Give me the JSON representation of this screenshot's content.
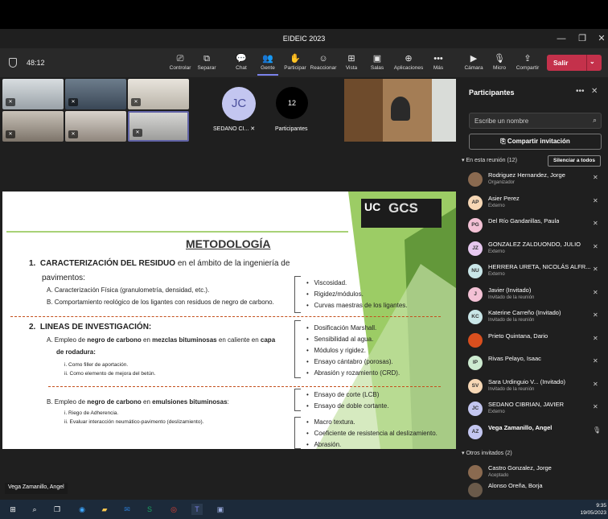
{
  "window": {
    "title": "EIDEIC 2023"
  },
  "toolbar": {
    "timer": "48:12",
    "buttons": [
      {
        "label": "Controlar",
        "icon": "screen-control-icon"
      },
      {
        "label": "Separar",
        "icon": "popout-icon"
      },
      {
        "label": "Chat",
        "icon": "chat-icon"
      },
      {
        "label": "Gente",
        "icon": "people-icon"
      },
      {
        "label": "Participar",
        "icon": "raise-hand-icon"
      },
      {
        "label": "Reaccionar",
        "icon": "smiley-icon"
      },
      {
        "label": "Vista",
        "icon": "grid-icon"
      },
      {
        "label": "Salas",
        "icon": "rooms-icon"
      },
      {
        "label": "Aplicaciones",
        "icon": "add-app-icon"
      },
      {
        "label": "Más",
        "icon": "more-icon"
      },
      {
        "label": "Cámara",
        "icon": "camera-icon"
      },
      {
        "label": "Micro",
        "icon": "mic-off-icon"
      },
      {
        "label": "Compartir",
        "icon": "share-icon"
      }
    ],
    "leave_label": "Salir"
  },
  "stage": {
    "avatar_initials": "JC",
    "avatar_name": "SEDANO CI...",
    "participant_count": "12",
    "participant_count_label": "Participantes",
    "speaker_name": "Vega Zamanillo, Angel"
  },
  "slide": {
    "logo_uc": "UC",
    "logo_gcs": "GCS",
    "title": "METODOLOGÍA",
    "s1_num": "1.",
    "s1_bold": "CARACTERIZACIÓN DEL RESIDUO",
    "s1_rest": " en el ámbito de la ingeniería de",
    "s1_cont": "pavimentos:",
    "s1_a": "A.  Caracterización Física (granulometría, densidad, etc.).",
    "s1_b": "B.  Comportamiento reológico de los ligantes con residuos de negro de carbono.",
    "s1_list": [
      "Viscosidad.",
      "Rigidez/módulos.",
      "Curvas maestras de los ligantes."
    ],
    "s2_num": "2.",
    "s2_bold": "LINEAS DE INVESTIGACIÓN:",
    "s2_a_pre": "A.  Empleo de ",
    "s2_a_b1": "negro de carbono",
    "s2_a_mid": " en ",
    "s2_a_b2": "mezclas bituminosas",
    "s2_a_post": " en caliente en ",
    "s2_a_b3": "capa",
    "s2_a_cont": "de rodadura:",
    "s2_a_i": "i.   Como filler de aportación.",
    "s2_a_ii": "ii.  Como elemento de mejora del betún.",
    "s2_a_list": [
      "Dosificación Marshall.",
      "Sensibilidad al agua.",
      "Módulos y rigidez.",
      "Ensayo cántabro (porosas).",
      "Abrasión y rozamiento (CRD)."
    ],
    "s2_b_pre": "B.   Empleo de ",
    "s2_b_b1": "negro de carbono",
    "s2_b_mid": " en ",
    "s2_b_b2": "emulsiones bituminosas",
    "s2_b_post": ":",
    "s2_b_i": "i.    Riego de Adherencia.",
    "s2_b_ii": "ii.   Evaluar interacción neumático-pavimento (deslizamiento).",
    "s2_b_list1": [
      "Ensayo de corte (LCB)",
      "Ensayo de doble cortante."
    ],
    "s2_b_list2": [
      "Macro textura.",
      "Coeficiente de resistencia al deslizamiento.",
      "Abrasión."
    ]
  },
  "panel": {
    "title": "Participantes",
    "search_placeholder": "Escribe un nombre",
    "invite_label": "Compartir invitación",
    "in_meeting": "En esta reunión (12)",
    "mute_all": "Silenciar a todos",
    "participants": [
      {
        "initials": "",
        "name": "Rodriguez Hernandez, Jorge",
        "sub": "Organizador",
        "color": "#8a6a50"
      },
      {
        "initials": "AP",
        "name": "Asier Perez",
        "sub": "Externo",
        "color": "#f6d7b5"
      },
      {
        "initials": "PG",
        "name": "Del Río Gandarillas, Paula",
        "sub": "",
        "color": "#f3c1d5"
      },
      {
        "initials": "JZ",
        "name": "GONZALEZ ZALDUONDO, JULIO",
        "sub": "Externo",
        "color": "#e7c8f0"
      },
      {
        "initials": "NU",
        "name": "HERRERA URETA, NICOLÁS ALFR...",
        "sub": "Externo",
        "color": "#c9e6e8"
      },
      {
        "initials": "J",
        "name": "Javier (Invitado)",
        "sub": "Invitado de la reunión",
        "color": "#f3c1d5"
      },
      {
        "initials": "KC",
        "name": "Katerine Carreño (Invitado)",
        "sub": "Invitado de la reunión",
        "color": "#c9e6e8"
      },
      {
        "initials": "",
        "name": "Prieto Quintana, Dario",
        "sub": "",
        "color": "#d94f1e"
      },
      {
        "initials": "IP",
        "name": "Rivas Pelayo, Isaac",
        "sub": "",
        "color": "#cdebd0"
      },
      {
        "initials": "SV",
        "name": "Sara Urdinguio V... (Invitado)",
        "sub": "Invitado de la reunión",
        "color": "#f6d7b5"
      },
      {
        "initials": "JC",
        "name": "SEDANO CIBRIAN, JAVIER",
        "sub": "Externo",
        "color": "#c3c6f0"
      },
      {
        "initials": "AZ",
        "name": "Vega Zamanillo, Angel",
        "sub": "",
        "color": "#c3c6f0"
      }
    ],
    "others": "Otros invitados (2)",
    "others_list": [
      {
        "initials": "",
        "name": "Castro Gonzalez, Jorge",
        "sub": "Aceptado",
        "color": "#8a6a50"
      },
      {
        "initials": "",
        "name": "Alonso Oreña, Borja",
        "sub": "",
        "color": "#6a5a4a"
      }
    ]
  },
  "taskbar": {
    "time": "9:35",
    "date": "19/05/2023"
  }
}
